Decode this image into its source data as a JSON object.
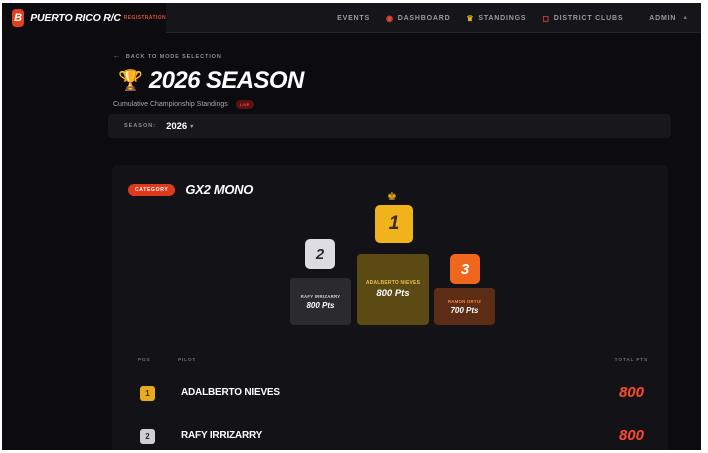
{
  "app": {
    "logo_letter": "B",
    "brand_name": "PUERTO RICO R/C",
    "brand_tag": "REGISTRATION"
  },
  "nav": {
    "items": [
      {
        "label": "EVENTS",
        "icon": ""
      },
      {
        "label": "DASHBOARD",
        "icon": "dashboard-icon"
      },
      {
        "label": "STANDINGS",
        "icon": "trophy-icon"
      },
      {
        "label": "DISTRICT CLUBS",
        "icon": "clubs-icon"
      },
      {
        "label": "ADMIN",
        "icon": ""
      }
    ],
    "admin_arrow": "▲"
  },
  "page": {
    "back_label": "BACK TO MODE SELECTION",
    "title": "2026 SEASON",
    "subtitle": "Cumulative Championship Standings",
    "live_badge": "LIVE",
    "season_label": "SEASON:",
    "season_value": "2026"
  },
  "category": {
    "badge": "CATEGORY",
    "name": "GX2 MONO"
  },
  "podium": [
    {
      "rank": "1",
      "name": "ADALBERTO NIEVES",
      "points": "800 Pts"
    },
    {
      "rank": "2",
      "name": "RAFY IRRIZARRY",
      "points": "800 Pts"
    },
    {
      "rank": "3",
      "name": "RAMON ORTIZ",
      "points": "700 Pts"
    }
  ],
  "table": {
    "headers": {
      "pos": "POS",
      "pilot": "PILOT",
      "total": "TOTAL PTS"
    },
    "rows": [
      {
        "pos": "1",
        "pilot": "ADALBERTO NIEVES",
        "total": "800"
      },
      {
        "pos": "2",
        "pilot": "RAFY IRRIZARRY",
        "total": "800"
      }
    ]
  },
  "colors": {
    "accent_red": "#e03a1c",
    "gold": "#f0b31c",
    "silver": "#dcdce2",
    "bronze": "#f0661c",
    "background": "#0c0c0f"
  }
}
